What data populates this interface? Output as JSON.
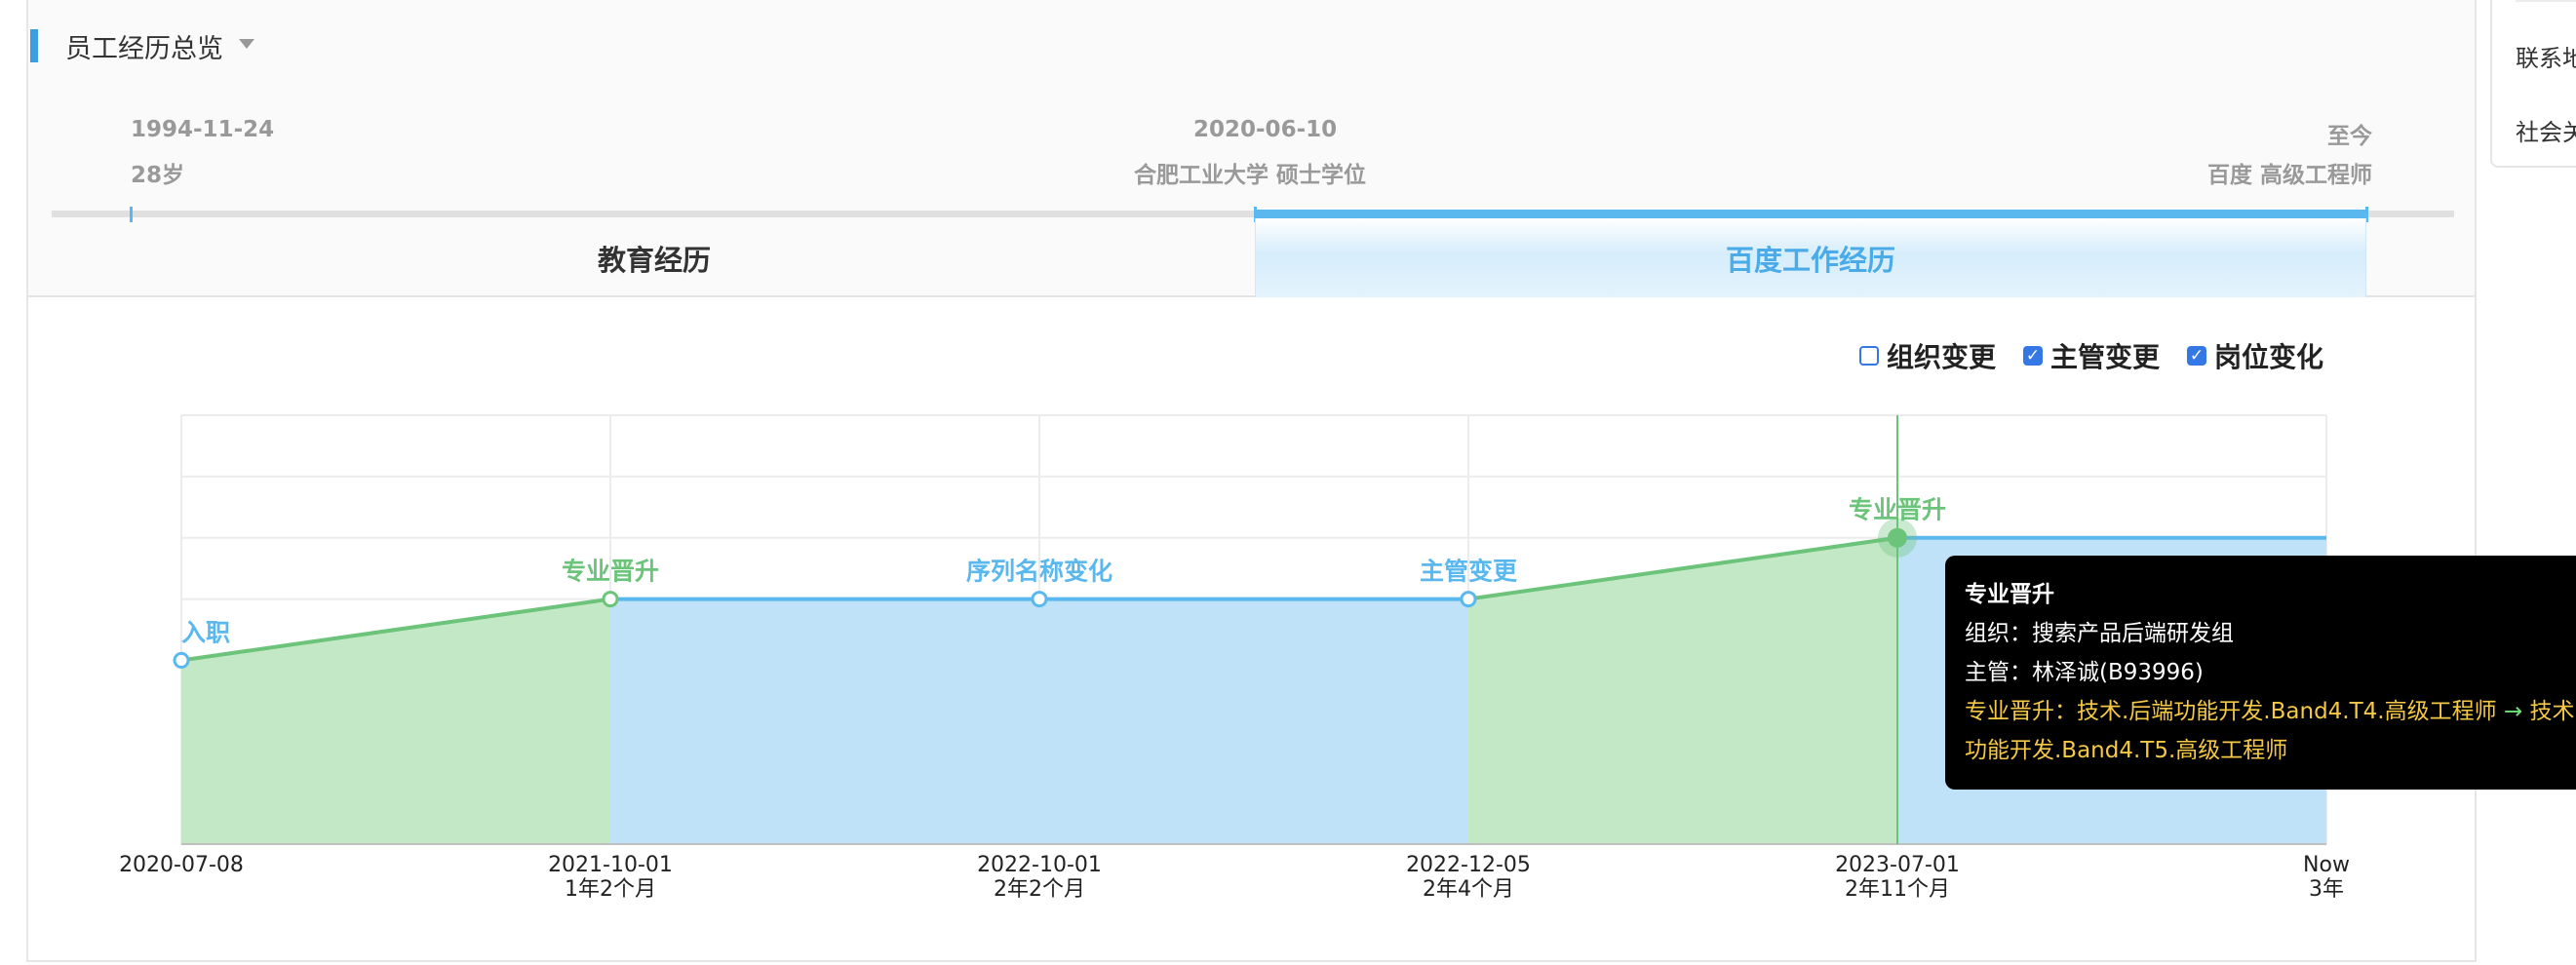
{
  "header": {
    "title": "员工经历总览"
  },
  "timeline": {
    "left": {
      "date": "1994-11-24",
      "sub": "28岁"
    },
    "middle": {
      "date": "2020-06-10",
      "sub": "合肥工业大学 硕士学位"
    },
    "right": {
      "date": "至今",
      "sub": "百度 高级工程师"
    }
  },
  "tabs": [
    {
      "label": "教育经历",
      "active": false
    },
    {
      "label": "百度工作经历",
      "active": true
    }
  ],
  "filters": [
    {
      "label": "组织变更",
      "checked": false
    },
    {
      "label": "主管变更",
      "checked": true
    },
    {
      "label": "岗位变化",
      "checked": true
    }
  ],
  "chart_data": {
    "type": "area",
    "x": [
      "2020-07-08",
      "2021-10-01",
      "2022-10-01",
      "2022-12-05",
      "2023-07-01",
      "Now"
    ],
    "x_sub": [
      "",
      "1年2个月",
      "2年2个月",
      "2年4个月",
      "2年11个月",
      "3年"
    ],
    "values": [
      3,
      4,
      4,
      4,
      5,
      5
    ],
    "event_labels": [
      "入职",
      "专业晋升",
      "序列名称变化",
      "主管变更",
      "专业晋升",
      ""
    ],
    "segment_colors": [
      "green",
      "blue",
      "blue",
      "green",
      "blue"
    ],
    "ylim": [
      0,
      7
    ],
    "grid": true,
    "highlight_index": 4,
    "colors": {
      "green_line": "#6cc47a",
      "green_fill": "#c2e8c6",
      "blue_line": "#5bb8ee",
      "blue_fill": "#bfe2f8",
      "label_green": "#6cc47a",
      "label_blue": "#5bb8ee"
    }
  },
  "tooltip": {
    "title": "专业晋升",
    "org": "组织：搜索产品后端研发组",
    "manager": "主管：林泽诚(B93996)",
    "change_prefix": "专业晋升：技术.后端功能开发.Band4.T4.高级工程师",
    "arrow": "→",
    "change_to": "技术.后端",
    "change_cont": "功能开发.Band4.T5.高级工程师"
  },
  "side": {
    "item1": "联系地",
    "item2": "社会关"
  }
}
